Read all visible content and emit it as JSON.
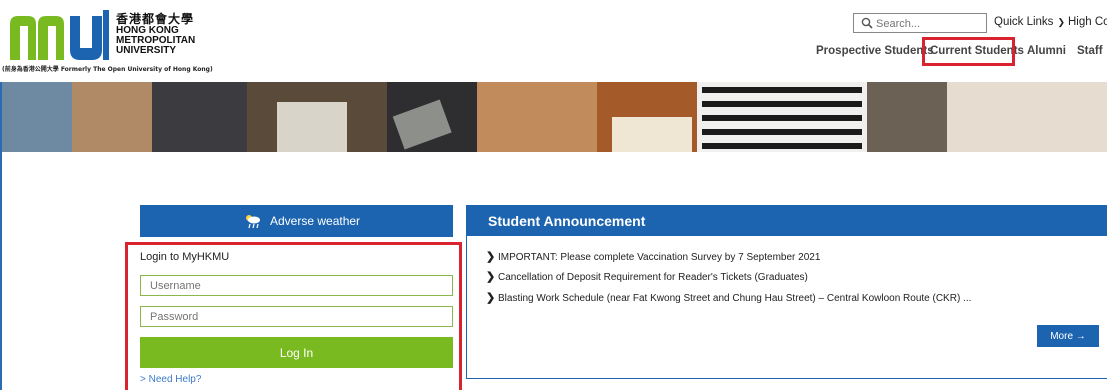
{
  "header": {
    "logo": {
      "chinese": "香港都會大學",
      "english_lines": [
        "HONG KONG",
        "METROPOLITAN",
        "UNIVERSITY"
      ],
      "formerly": "(前身為香港公開大學 Formerly The Open University of Hong Kong)",
      "mark_color": "#7aba21",
      "mark_accent": "#1d64b0"
    },
    "search": {
      "placeholder": "Search..."
    },
    "quick_links": "Quick Links",
    "high_contrast": "High Con",
    "nav": [
      "Prospective Students",
      "Current Students",
      "Alumni",
      "Staff"
    ]
  },
  "weather": {
    "label": "Adverse weather"
  },
  "login": {
    "title": "Login to MyHKMU",
    "username_placeholder": "Username",
    "password_placeholder": "Password",
    "button": "Log In",
    "help": "> Need Help?"
  },
  "announcement": {
    "title": "Student Announcement",
    "items": [
      "IMPORTANT: Please complete Vaccination Survey by 7 September 2021",
      "Cancellation of Deposit Requirement for Reader's Tickets (Graduates)",
      "Blasting Work Schedule (near Fat Kwong Street and Chung Hau Street) – Central Kowloon Route (CKR) ..."
    ],
    "more": "More →"
  },
  "colors": {
    "primary": "#1d64b0",
    "green": "#7aba21",
    "highlight": "#d9232e"
  }
}
